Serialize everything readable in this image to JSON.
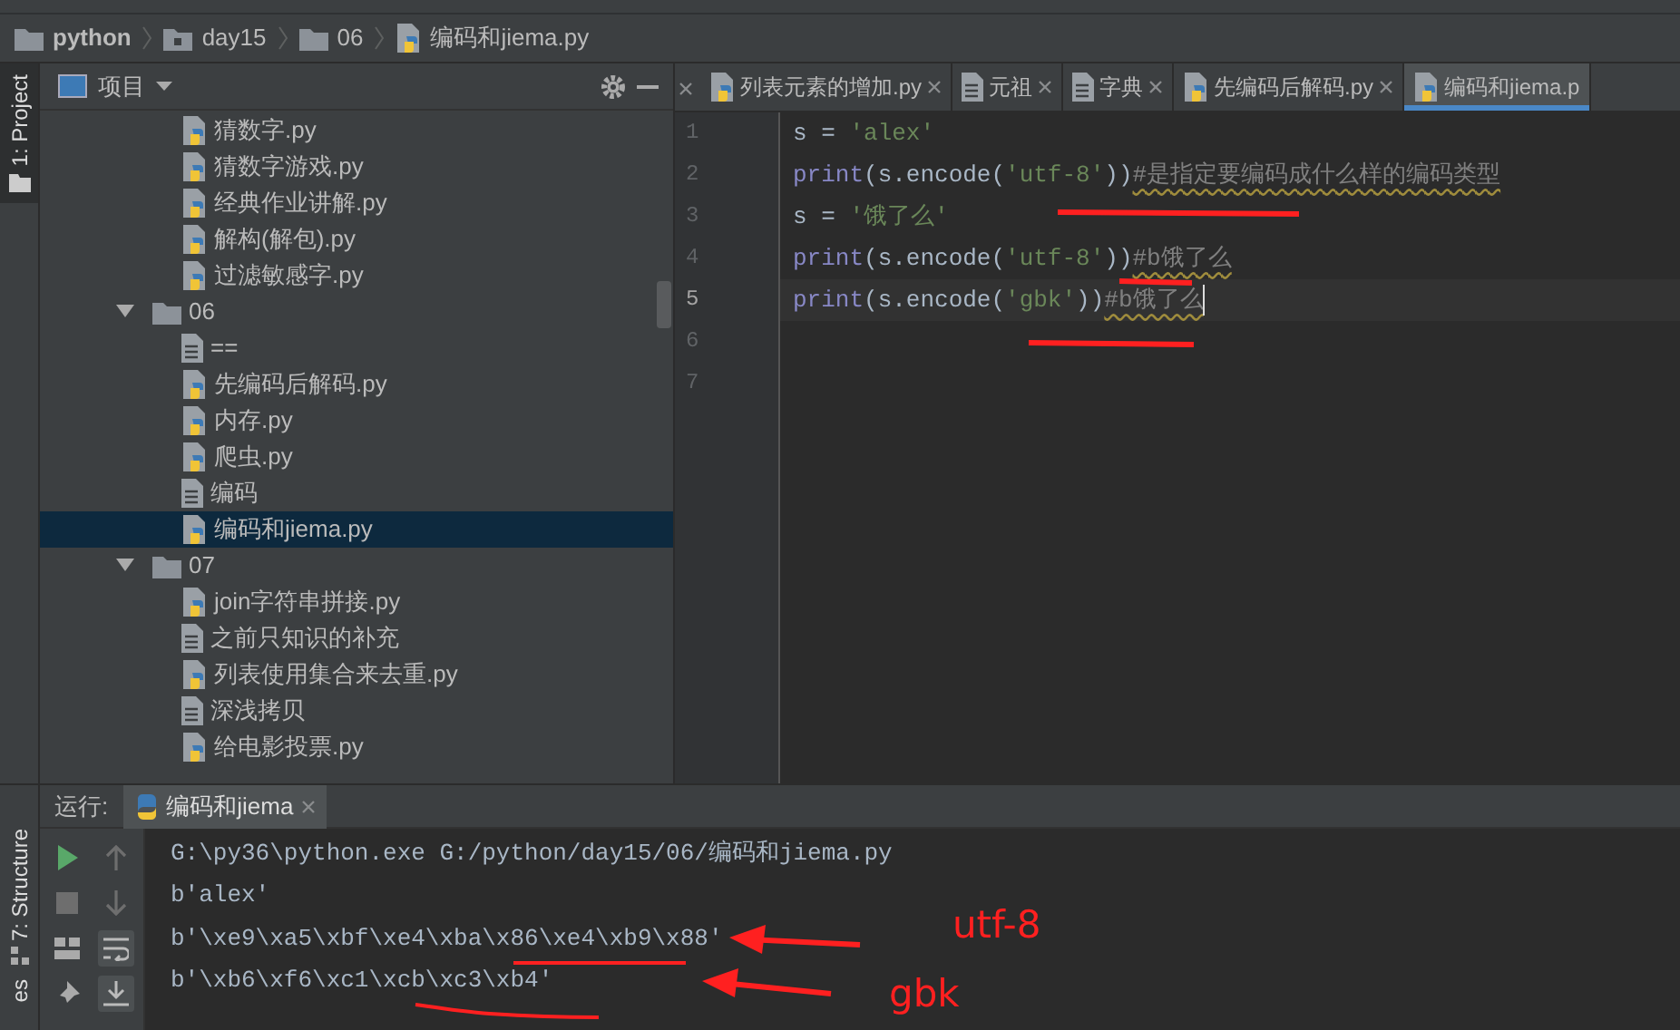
{
  "breadcrumb": [
    {
      "label": "python",
      "kind": "folder",
      "bold": true
    },
    {
      "label": "day15",
      "kind": "module"
    },
    {
      "label": "06",
      "kind": "folder",
      "bold": false
    },
    {
      "label": "编码和jiema.py",
      "kind": "python"
    }
  ],
  "left_strip": {
    "label": "1: Project"
  },
  "project_panel": {
    "title": "项目",
    "items": [
      {
        "label": "猜数字.py",
        "kind": "python",
        "selected": false
      },
      {
        "label": "猜数字游戏.py",
        "kind": "python",
        "selected": false
      },
      {
        "label": "经典作业讲解.py",
        "kind": "python",
        "selected": false
      },
      {
        "label": "解构(解包).py",
        "kind": "python",
        "selected": false
      },
      {
        "label": "过滤敏感字.py",
        "kind": "python",
        "selected": false
      },
      {
        "label": "06",
        "kind": "folder",
        "expanded": true,
        "selected": false,
        "children": [
          {
            "label": "==",
            "kind": "text",
            "selected": false
          },
          {
            "label": "先编码后解码.py",
            "kind": "python",
            "selected": false
          },
          {
            "label": "内存.py",
            "kind": "python",
            "selected": false
          },
          {
            "label": "爬虫.py",
            "kind": "python",
            "selected": false
          },
          {
            "label": "编码",
            "kind": "text",
            "selected": false
          },
          {
            "label": "编码和jiema.py",
            "kind": "python",
            "selected": true
          }
        ]
      },
      {
        "label": "07",
        "kind": "folder",
        "expanded": true,
        "selected": false,
        "children": [
          {
            "label": "join字符串拼接.py",
            "kind": "python",
            "selected": false
          },
          {
            "label": "之前只知识的补充",
            "kind": "text",
            "selected": false
          },
          {
            "label": "列表使用集合来去重.py",
            "kind": "python",
            "selected": false
          },
          {
            "label": "深浅拷贝",
            "kind": "text",
            "selected": false
          },
          {
            "label": "给电影投票.py",
            "kind": "python",
            "selected": false
          }
        ]
      }
    ]
  },
  "editor_tabs": [
    {
      "label": "列表元素的增加.py",
      "kind": "python",
      "selected": false
    },
    {
      "label": "元祖",
      "kind": "text",
      "selected": false
    },
    {
      "label": "字典",
      "kind": "text",
      "selected": false
    },
    {
      "label": "先编码后解码.py",
      "kind": "python",
      "selected": false
    },
    {
      "label": "编码和jiema.p",
      "kind": "python",
      "selected": true
    }
  ],
  "code": [
    {
      "number": "1",
      "current": false,
      "tokens": [
        {
          "kind": "plain",
          "text": "s = "
        },
        {
          "kind": "string",
          "text": "'alex'"
        }
      ]
    },
    {
      "number": "2",
      "current": false,
      "tokens": [
        {
          "kind": "builtin",
          "text": "print"
        },
        {
          "kind": "plain",
          "text": "(s.encode("
        },
        {
          "kind": "string",
          "text": "'utf-8'"
        },
        {
          "kind": "plain",
          "text": "))"
        },
        {
          "kind": "comment",
          "text": "#是指定要编码成什么样的编码类型"
        }
      ]
    },
    {
      "number": "3",
      "current": false,
      "tokens": [
        {
          "kind": "plain",
          "text": "s = "
        },
        {
          "kind": "string",
          "text": "'饿了么'"
        }
      ]
    },
    {
      "number": "4",
      "current": false,
      "tokens": [
        {
          "kind": "builtin",
          "text": "print"
        },
        {
          "kind": "plain",
          "text": "(s.encode("
        },
        {
          "kind": "string",
          "text": "'utf-8'"
        },
        {
          "kind": "plain",
          "text": "))"
        },
        {
          "kind": "comment",
          "text": "#b饿了么"
        }
      ]
    },
    {
      "number": "5",
      "current": true,
      "tokens": [
        {
          "kind": "builtin",
          "text": "print"
        },
        {
          "kind": "plain",
          "text": "(s.encode("
        },
        {
          "kind": "string",
          "text": "'gbk'"
        },
        {
          "kind": "plain",
          "text": "))"
        },
        {
          "kind": "comment",
          "text": "#b饿了么"
        }
      ]
    },
    {
      "number": "6",
      "current": false
    },
    {
      "number": "7",
      "current": false
    }
  ],
  "run_panel": {
    "label": "运行:",
    "tab": "编码和jiema",
    "side_label": "7: Structure",
    "side_label_2": "es",
    "output": [
      "G:\\py36\\python.exe G:/python/day15/06/编码和jiema.py",
      "b'alex'",
      "b'\\xe9\\xa5\\xbf\\xe4\\xba\\x86\\xe4\\xb9\\x88'",
      "b'\\xb6\\xf6\\xc1\\xcb\\xc3\\xb4'"
    ]
  },
  "annotations": [
    {
      "text": "utf-8"
    },
    {
      "text": "gbk"
    }
  ]
}
